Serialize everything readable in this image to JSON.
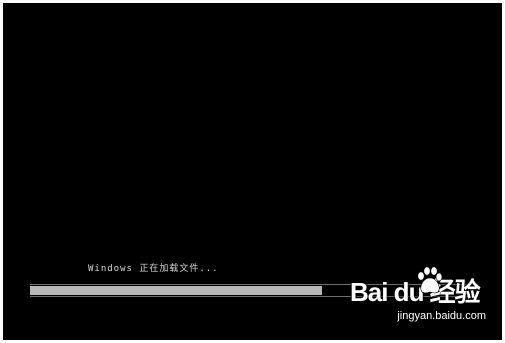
{
  "screen": {
    "loading_text": "Windows 正在加载文件...",
    "progress_fraction": 0.66,
    "colors": {
      "background": "#000000",
      "progress_fill": "#b8b8b8",
      "text": "#d8d8d8"
    }
  },
  "watermark": {
    "logo_text": "Bai du 经验",
    "url": "jingyan.baidu.com"
  }
}
